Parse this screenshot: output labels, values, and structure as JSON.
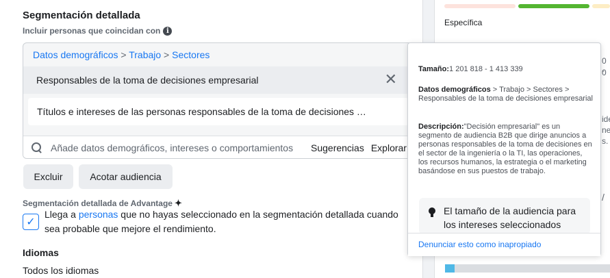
{
  "detailed": {
    "title": "Segmentación detallada",
    "include_label": "Incluir personas que coincidan con",
    "breadcrumb": [
      "Datos demográficos",
      "Trabajo",
      "Sectores"
    ],
    "breadcrumb_sep": " > ",
    "selected_item": "Responsables de la toma de decisiones empresarial",
    "suggestion": "Títulos e intereses de las personas responsables de la toma de decisiones …",
    "search_placeholder": "Añade datos demográficos, intereses o comportamientos",
    "suggestions_label": "Sugerencias",
    "explore_label": "Explorar",
    "exclude_label": "Excluir",
    "narrow_label": "Acotar audiencia"
  },
  "advantage": {
    "label": "Segmentación detallada de Advantage",
    "text_before": "Llega a ",
    "link": "personas",
    "text_after": " que no hayas seleccionado en la segmentación detallada cuando sea probable que mejore el rendimiento.",
    "checked": true
  },
  "languages": {
    "title": "Idiomas",
    "value": "Todos los idiomas"
  },
  "audience_meter": {
    "label": "Específica",
    "colors": [
      "#fde3dd",
      "#54b531",
      "#fdedc4"
    ]
  },
  "right_peek": {
    "line1": "0 -",
    "line2": "0",
    "line3": "ide",
    "line4": "ne",
    "line5": "s.",
    "line6": "/"
  },
  "tooltip": {
    "size_label": "Tamaño:",
    "size_value": "1 201 818 - 1 413 339",
    "category_label": "Datos demográficos",
    "category_path": " > Trabajo > Sectores > Responsables de la toma de decisiones empresarial",
    "description_label": "Descripción:",
    "description_value": "\"Decisión empresarial\" es un segmento de audiencia B2B que dirige anuncios a personas responsables de la toma de decisiones en el sector de la ingeniería o la TI, las operaciones, los recursos humanos, la estrategia o el marketing basándose en sus puestos de trabajo.",
    "tip": "El tamaño de la audiencia para los intereses seleccionados",
    "report_link": "Denunciar esto como inapropiado"
  }
}
